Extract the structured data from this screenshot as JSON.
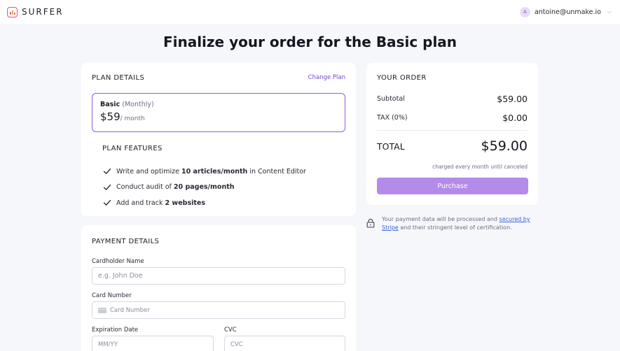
{
  "header": {
    "brand": "SURFER",
    "avatar_initial": "A",
    "account_email": "antoine@unmake.io",
    "dropdown_glyph": "⌵"
  },
  "page": {
    "title": "Finalize your order for the Basic plan"
  },
  "plan_details": {
    "section_title": "PLAN DETAILS",
    "change_link": "Change Plan",
    "plan_name": "Basic",
    "plan_period": "(Monthly)",
    "price": "$59",
    "price_suffix": "/ month",
    "features_title": "PLAN FEATURES",
    "features": [
      {
        "before": "Write and optimize ",
        "bold": "10 articles/month",
        "after": " in Content Editor"
      },
      {
        "before": "Conduct audit of ",
        "bold": "20 pages/month",
        "after": ""
      },
      {
        "before": "Add and track ",
        "bold": "2 websites",
        "after": ""
      }
    ]
  },
  "order": {
    "section_title": "YOUR ORDER",
    "subtotal_label": "Subtotal",
    "subtotal_value": "$59.00",
    "tax_label": "TAX (0%)",
    "tax_value": "$0.00",
    "total_label": "TOTAL",
    "total_value": "$59.00",
    "charged_note": "charged every month until canceled",
    "purchase_label": "Purchase",
    "secure_note_before": "Your payment data will be processed and ",
    "secure_note_link": "secured by Stripe",
    "secure_note_after": " and their stringent level of certification."
  },
  "payment": {
    "section_title": "PAYMENT DETAILS",
    "cardholder_label": "Cardholder Name",
    "cardholder_placeholder": "e.g. John Doe",
    "card_number_label": "Card Number",
    "card_number_placeholder": "Card Number",
    "expiration_label": "Expiration Date",
    "expiration_placeholder": "MM/YY",
    "cvc_label": "CVC",
    "cvc_placeholder": "CVC"
  },
  "colors": {
    "accent": "#7645cf",
    "plan_border": "#8e5ce0",
    "purchase_button": "#b48be9",
    "link": "#3b63d6"
  }
}
